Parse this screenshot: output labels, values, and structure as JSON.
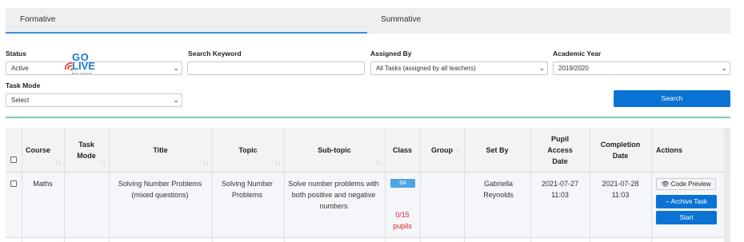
{
  "tabs": [
    {
      "label": "Formative",
      "active": true
    },
    {
      "label": "Summative",
      "active": false
    }
  ],
  "filters": {
    "status": {
      "label": "Status",
      "value": "Active"
    },
    "search_keyword": {
      "label": "Search Keyword",
      "value": ""
    },
    "assigned_by": {
      "label": "Assigned By",
      "value": "All Tasks (assigned by all teachers)"
    },
    "academic_year": {
      "label": "Academic Year",
      "value": "2019/2020"
    },
    "task_mode": {
      "label": "Task Mode",
      "value": "Select"
    },
    "search_button": "Search"
  },
  "table": {
    "columns": [
      {
        "key": "course",
        "label": "Course"
      },
      {
        "key": "task_mode",
        "label": "Task\nMode"
      },
      {
        "key": "title",
        "label": "Title"
      },
      {
        "key": "topic",
        "label": "Topic"
      },
      {
        "key": "subtopic",
        "label": "Sub-topic"
      },
      {
        "key": "class",
        "label": "Class"
      },
      {
        "key": "group",
        "label": "Group"
      },
      {
        "key": "set_by",
        "label": "Set By"
      },
      {
        "key": "access_date",
        "label": "Pupil\nAccess\nDate"
      },
      {
        "key": "completion_date",
        "label": "Completion\nDate"
      },
      {
        "key": "actions",
        "label": "Actions"
      }
    ],
    "rows": [
      {
        "course": "Maths",
        "task_mode_logo": {
          "line1": "GO",
          "line2": "LIVE",
          "tag": "BETA VERSION"
        },
        "title": "Solving Number Problems (mixed questions)",
        "topic": "Solving Number Problems",
        "subtopic": "Solve number problems with both positive and negative numbers",
        "class_badge": "6A",
        "pupils": "0/15\npupils",
        "group": "",
        "set_by": "Gabriella Reynolds",
        "access_date": "2021-07-27\n11:03",
        "completion_date": "2021-07-28\n11:03",
        "actions": {
          "code_preview": "Code Preview",
          "archive": "Archive Task",
          "start": "Start"
        }
      }
    ]
  },
  "colors": {
    "accent": "#0a73d4",
    "tab_underline": "#3f8fd4",
    "divider": "#7fc9b9",
    "badge": "#4ea7e0",
    "warning_text": "#dd2222"
  },
  "icons": {
    "sort": "sort-arrows-icon",
    "dropdown": "chevron-down-icon",
    "eye": "eye-icon",
    "minus": "minus-icon"
  }
}
